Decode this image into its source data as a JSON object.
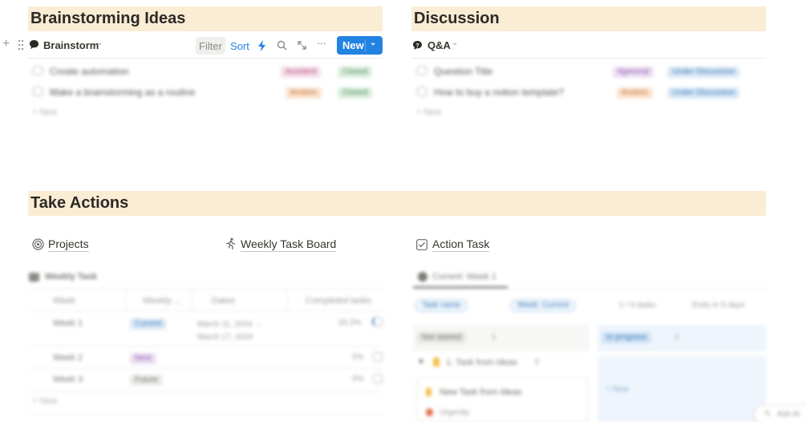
{
  "brainstorming": {
    "title": "Brainstorming Ideas",
    "view_label": "Brainstorm",
    "filter_label": "Filter",
    "sort_label": "Sort",
    "new_label": "New",
    "rows": [
      {
        "title": "Create automation",
        "tag": "#content",
        "status": "Closed"
      },
      {
        "title": "Make a brainstorming as a routine",
        "tag": "#notion",
        "status": "Closed"
      }
    ],
    "add_label": "+ New"
  },
  "discussion": {
    "title": "Discussion",
    "view_label": "Q&A",
    "rows": [
      {
        "title": "Question Title",
        "tag": "#general",
        "status": "Under Discussion"
      },
      {
        "title": "How to buy a notion template?",
        "tag": "#notion",
        "status": "Under Discussion"
      }
    ],
    "add_label": "+ New"
  },
  "actions": {
    "title": "Take Actions",
    "projects_label": "Projects",
    "weekly_board_label": "Weekly Task Board",
    "action_task_label": "Action Task",
    "weekly": {
      "view_label": "Weekly Task",
      "columns": [
        "Week",
        "Weekly ...",
        "Dates",
        "Completed tasks"
      ],
      "rows": [
        {
          "name": "Week 1",
          "status": "Current",
          "dates": "March 11, 2024 → March 17, 2024",
          "completed": "33.3%"
        },
        {
          "name": "Week 2",
          "status": "Next",
          "dates": "",
          "completed": "0%"
        },
        {
          "name": "Week 3",
          "status": "Future",
          "dates": "",
          "completed": "0%"
        }
      ],
      "add_label": "+ New"
    },
    "tasks": {
      "view_label": "Current: Week 1",
      "filter_task": "Task name",
      "filter_week": "Week: Current",
      "progress": "1 / 6 tasks",
      "ends": "Ends in 5 days",
      "not_started": "Not started",
      "not_started_count": "1",
      "in_progress": "In progress",
      "in_progress_count": "1",
      "group_label": "1. Task from ideas",
      "group_count": "3",
      "card_title": "New Task from Ideas",
      "card_priority": "Urgently",
      "new_label": "+ New"
    }
  },
  "ask_ai": "Ask AI",
  "colors": {
    "header_band": "#fbecd4",
    "primary": "#2383e2"
  }
}
